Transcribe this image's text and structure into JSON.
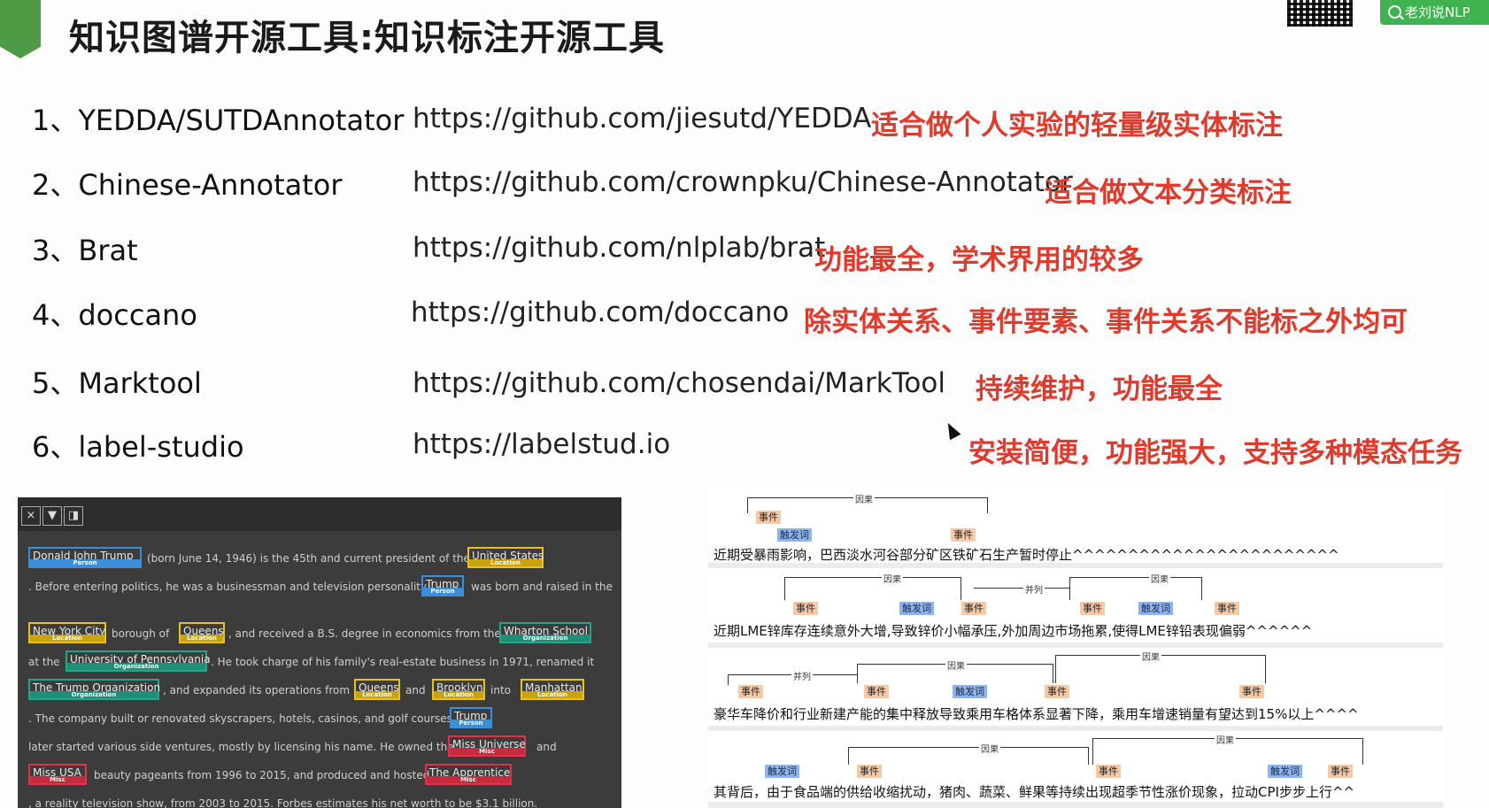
{
  "header": {
    "title": "知识图谱开源工具:知识标注开源工具",
    "badge_label": "老刘说NLP"
  },
  "tools": [
    {
      "name": "1、YEDDA/SUTDAnnotator",
      "url": "https://github.com/jiesutd/YEDDA",
      "note": "适合做个人实验的轻量级实体标注"
    },
    {
      "name": "2、Chinese-Annotator",
      "url": "https://github.com/crownpku/Chinese-Annotator",
      "note": "适合做文本分类标注"
    },
    {
      "name": "3、Brat",
      "url": "https://github.com/nlplab/brat",
      "note": "功能最全，学术界用的较多"
    },
    {
      "name": "4、doccano",
      "url": "https://github.com/doccano",
      "note": "除实体关系、事件要素、事件关系不能标之外均可"
    },
    {
      "name": "5、Marktool",
      "url": "https://github.com/chosendai/MarkTool",
      "note": "持续维护，功能最全"
    },
    {
      "name": "6、label-studio",
      "url": "https://labelstud.io",
      "note": "安装简便，功能强大，支持多种模态任务"
    }
  ],
  "ner_panel": {
    "toolbar": {
      "close": "×",
      "filter": "▼",
      "view": "◨"
    },
    "labels": {
      "person": "Person",
      "location": "Location",
      "organization": "Organization",
      "misc": "Misc"
    },
    "entities": {
      "donald": "Donald John Trump",
      "us": "United States",
      "trump1": "Trump",
      "nyc": "New York City",
      "queens1": "Queens",
      "wharton": "Wharton School",
      "upenn": "University of Pennsylvania",
      "trumporg": "The Trump Organization",
      "queens2": "Queens",
      "brooklyn": "Brooklyn",
      "manhattan": "Manhattan",
      "trump2": "Trump",
      "missuniverse": "Miss Universe",
      "missusa": "Miss USA",
      "apprentice": "The Apprentice"
    },
    "text": {
      "l1a": "(born June 14, 1946) is the 45th and current president of the",
      "l2a": ". Before entering politics, he was a businessman and television personality.",
      "l2b": "was born and raised in the",
      "l3a": "borough of",
      "l3b": ", and received a B.S. degree in economics from the",
      "l4a": "at the",
      "l4b": ". He took charge of his family's real-estate business in 1971, renamed it",
      "l5a": ", and expanded its operations from",
      "l5b": "and",
      "l5c": "into",
      "l6a": ". The company built or renovated skyscrapers, hotels, casinos, and golf courses.",
      "l7a": "later started various side ventures, mostly by licensing his name. He owned the",
      "l7b": "and",
      "l8a": "beauty pageants from 1996 to 2015, and produced and hosted",
      "l9a": ", a reality television show, from 2003 to 2015. Forbes estimates his net worth to be $3.1 billion."
    }
  },
  "event_panel": {
    "tags": {
      "event": "事件",
      "trigger": "触发词",
      "causal": "因果",
      "parallel": "并列"
    },
    "sentences": [
      "近期受暴雨影响，巴西淡水河谷部分矿区铁矿石生产暂时停止^^^^^^^^^^^^^^^^^^^^^^^^",
      "近期LME锌库存连续意外大增,导致锌价小幅承压,外加周边市场拖累,使得LME锌铅表现偏弱^^^^^^",
      "豪华车降价和行业新建产能的集中释放导致乘用车格体系显著下降，乘用车增速销量有望达到15%以上^^^^",
      "其背后，由于食品端的供给收缩扰动，猪肉、蔬菜、鲜果等持续出现超季节性涨价现象，拉动CPI步步上行^^"
    ]
  }
}
